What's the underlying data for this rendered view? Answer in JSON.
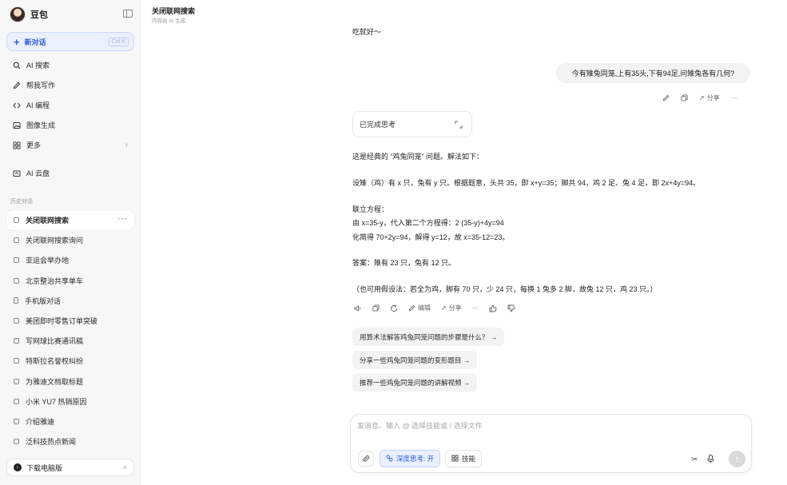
{
  "app": {
    "name": "豆包"
  },
  "sidebar": {
    "new_chat": {
      "label": "新对话",
      "shortcut": "Ctrl K"
    },
    "nav": [
      {
        "label": "AI 搜索",
        "icon": "search-icon"
      },
      {
        "label": "帮我写作",
        "icon": "pen-icon"
      },
      {
        "label": "AI 编程",
        "icon": "code-icon"
      },
      {
        "label": "图像生成",
        "icon": "image-icon"
      },
      {
        "label": "更多",
        "icon": "grid-icon"
      }
    ],
    "cloud": {
      "label": "AI 云盘"
    },
    "history_title": "历史对话",
    "history": [
      "关闭联网搜索",
      "关闭联网搜索询问",
      "亚运会举办地",
      "北京整治共享单车",
      "手机版对话",
      "美团即时零售订单突破",
      "写网球比赛通讯稿",
      "特斯拉名誉权纠纷",
      "为雅迪文档取标题",
      "小米 YU7 热销原因",
      "介绍雅迪",
      "泛科技热点新闻"
    ],
    "download": {
      "label": "下载电脑版"
    }
  },
  "header": {
    "title": "关闭联网搜索",
    "subtitle": "内容由 AI 生成"
  },
  "messages": {
    "prev_tail": "吃就好～",
    "user": "今有雉兔同笼,上有35头,下有94足,问雉兔各有几何?",
    "user_actions": {
      "share": "分享"
    },
    "thinking": "已完成思考",
    "answer": [
      "这是经典的 “鸡兔同笼” 问题。解法如下：",
      "设雉（鸡）有 x 只，兔有 y 只。根据题意，头共 35，即 x+y=35；脚共 94，鸡 2 足、兔 4 足，即 2x+4y=94。",
      "联立方程：",
      "由 x=35-y，代入第二个方程得：2 (35-y)+4y=94",
      "化简得 70+2y=94，解得 y=12，故 x=35-12=23。",
      "答案：雉有 23 只，兔有 12 只。",
      "（也可用假设法：若全为鸡，脚有 70 只，少 24 只，每换 1 兔多 2 脚，故兔 12 只，鸡 23 只。）"
    ],
    "bot_actions": {
      "edit": "编辑",
      "share": "分享"
    },
    "suggestions": [
      "用算术法解答鸡兔同笼问题的步骤是什么？ →",
      "分享一些鸡兔同笼问题的变形题目 →",
      "推荐一些鸡兔同笼问题的讲解视频 →"
    ]
  },
  "composer": {
    "placeholder": "发消息、输入 @ 选择技能或 / 选择文件",
    "deep_think": "深度思考: 开",
    "skills": "技能"
  },
  "colors": {
    "accent": "#2e5bd8",
    "accent_bg": "#eaf0fe"
  }
}
